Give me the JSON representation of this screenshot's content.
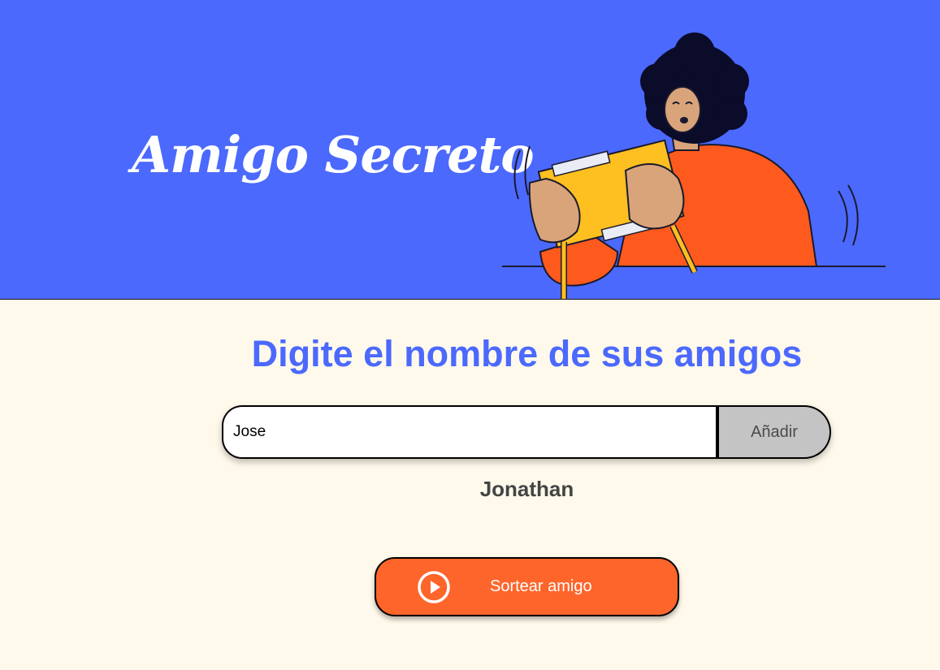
{
  "header": {
    "title": "Amigo Secreto",
    "illustration_icon": "person-holding-gift-illustration",
    "background_color": "#4B69FD"
  },
  "main": {
    "subtitle": "Digite el nombre de sus amigos",
    "name_input": {
      "value": "Jose"
    },
    "add_button_label": "Añadir",
    "friends": [
      "Jonathan"
    ],
    "draw_button_label": "Sortear amigo",
    "draw_button_icon": "play-circle-icon",
    "background_color": "#FFF9EB"
  },
  "colors": {
    "accent_blue": "#4B69FD",
    "accent_orange": "#FE652B",
    "button_gray": "#C4C4C4"
  }
}
